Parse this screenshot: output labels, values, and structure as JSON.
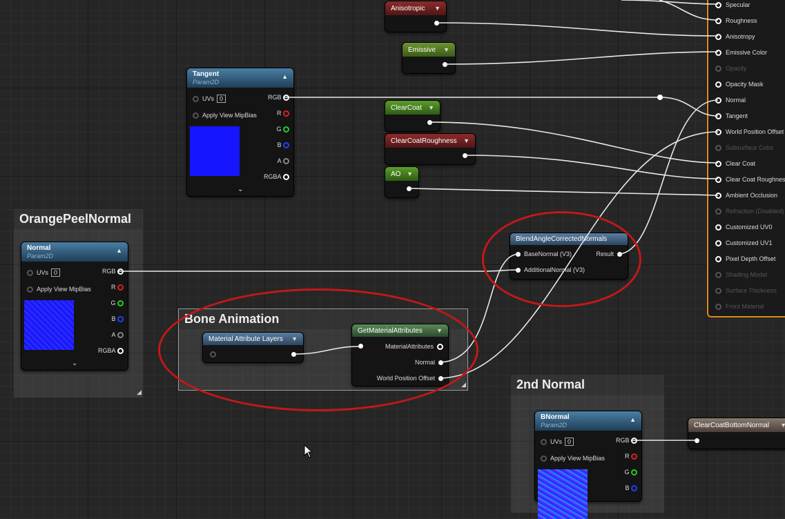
{
  "comments": {
    "orange_peel": "OrangePeelNormal",
    "bone_animation": "Bone Animation",
    "second_normal": "2nd Normal"
  },
  "nodes": {
    "anisotropic": "Anisotropic",
    "emissive": "Emissive",
    "clearcoat": "ClearCoat",
    "clearcoat_roughness": "ClearCoatRoughness",
    "ao": "AO",
    "clearcoat_bottom_normal": "ClearCoatBottomNormal",
    "tangent": {
      "title": "Tangent",
      "subtitle": "Param2D",
      "uvs": "UVs",
      "uv_value": "0",
      "mip": "Apply View MipBias",
      "outputs": [
        "RGB",
        "R",
        "G",
        "B",
        "A",
        "RGBA"
      ],
      "thumb_color": "#1515ff"
    },
    "normal": {
      "title": "Normal",
      "subtitle": "Param2D",
      "uvs": "UVs",
      "uv_value": "0",
      "mip": "Apply View MipBias",
      "outputs": [
        "RGB",
        "R",
        "G",
        "B",
        "A",
        "RGBA"
      ],
      "thumb_color": "#1a1aff"
    },
    "bnormal": {
      "title": "BNormal",
      "subtitle": "Param2D",
      "uvs": "UVs",
      "uv_value": "0",
      "mip": "Apply View MipBias",
      "outputs": [
        "RGB",
        "R",
        "G",
        "B"
      ],
      "thumb_color": "#2233ff"
    },
    "blend": {
      "title": "BlendAngleCorrectedNormals",
      "in1": "BaseNormal (V3)",
      "in2": "AdditionalNormal (V3)",
      "out": "Result"
    },
    "mal": {
      "title": "Material Attribute Layers"
    },
    "gma": {
      "title": "GetMaterialAttributes",
      "in": "MaterialAttributes",
      "out1": "Normal",
      "out2": "World Position Offset"
    }
  },
  "material_pins": [
    {
      "label": "Specular",
      "enabled": true
    },
    {
      "label": "Roughness",
      "enabled": true
    },
    {
      "label": "Anisotropy",
      "enabled": true
    },
    {
      "label": "Emissive Color",
      "enabled": true
    },
    {
      "label": "Opacity",
      "enabled": false
    },
    {
      "label": "Opacity Mask",
      "enabled": true
    },
    {
      "label": "Normal",
      "enabled": true
    },
    {
      "label": "Tangent",
      "enabled": true
    },
    {
      "label": "World Position Offset",
      "enabled": true
    },
    {
      "label": "Subsurface Color",
      "enabled": false
    },
    {
      "label": "Clear Coat",
      "enabled": true
    },
    {
      "label": "Clear Coat Roughness",
      "enabled": true
    },
    {
      "label": "Ambient Occlusion",
      "enabled": true
    },
    {
      "label": "Refraction (Disabled)",
      "enabled": false
    },
    {
      "label": "Customized UV0",
      "enabled": true
    },
    {
      "label": "Customized UV1",
      "enabled": true
    },
    {
      "label": "Pixel Depth Offset",
      "enabled": true
    },
    {
      "label": "Shading Model",
      "enabled": false
    },
    {
      "label": "Surface Thickness",
      "enabled": false
    },
    {
      "label": "Front Material",
      "enabled": false
    }
  ],
  "colors": {
    "accent_orange": "#e08a1c",
    "highlight_red": "#c41818",
    "pin_r": "#e02020",
    "pin_g": "#20d020",
    "pin_b": "#2040ff"
  },
  "icons": {
    "collapse": "chevron-up-icon",
    "expand": "chevron-down-icon",
    "cursor": "mouse-pointer-icon"
  }
}
